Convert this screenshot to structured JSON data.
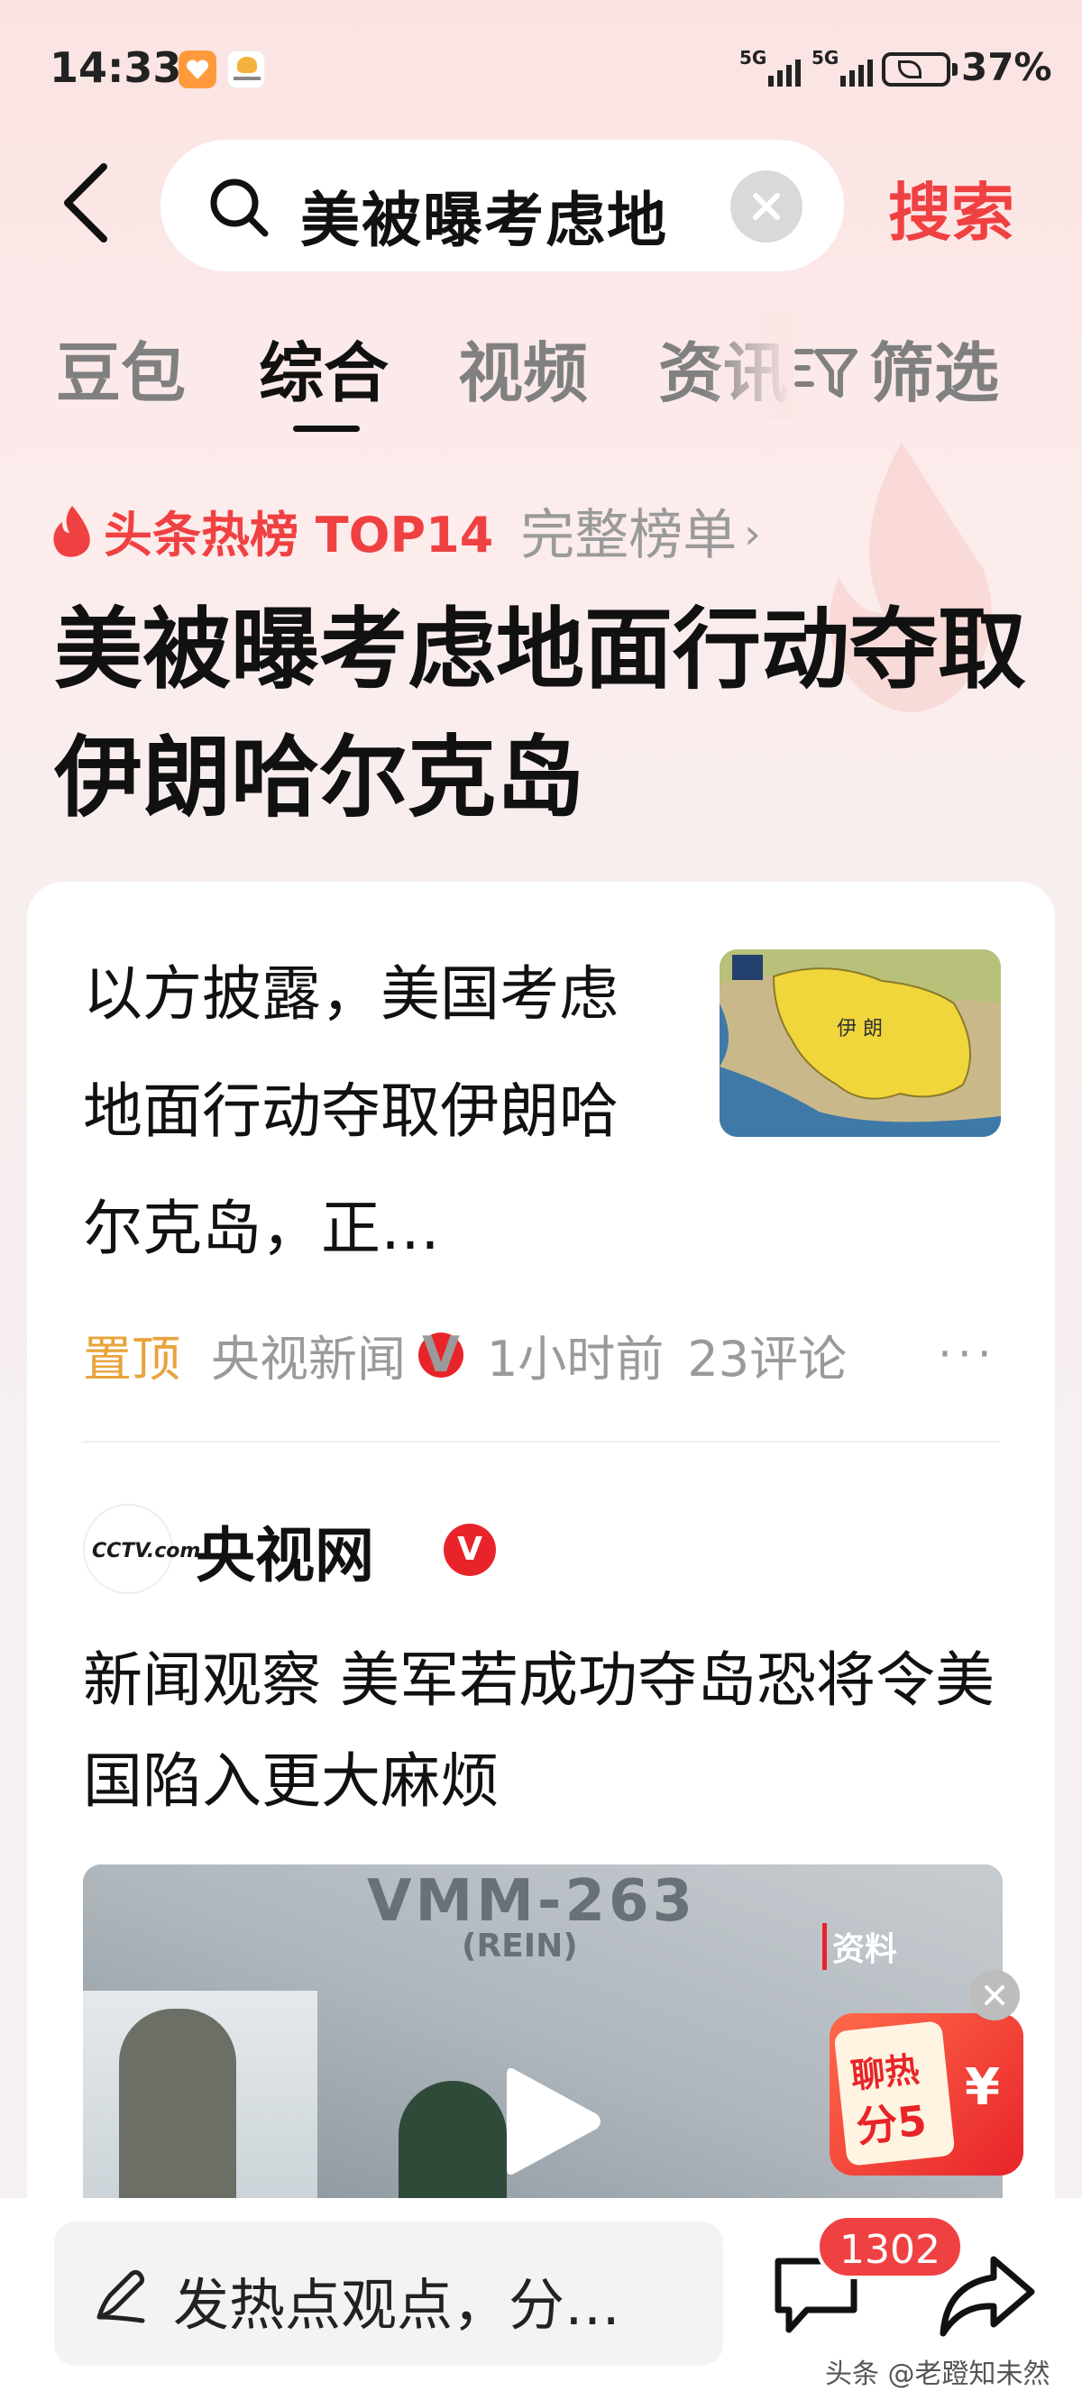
{
  "status_bar": {
    "time": "14:33",
    "network_1": "5G",
    "network_2": "5G",
    "battery_percent": "37%",
    "battery_level": 0.37
  },
  "search": {
    "query": "美被曝考虑地",
    "search_button": "搜索"
  },
  "tabs": [
    {
      "label": "豆包",
      "active": false
    },
    {
      "label": "综合",
      "active": true
    },
    {
      "label": "视频",
      "active": false
    },
    {
      "label": "资讯",
      "active": false
    }
  ],
  "filter_label": "筛选",
  "hot": {
    "tag": "头条热榜 TOP14",
    "full_list": "完整榜单",
    "title": "美被曝考虑地面行动夺取伊朗哈尔克岛"
  },
  "article1": {
    "title": "以方披露，美国考虑地面行动夺取伊朗哈尔克岛，正…",
    "thumb_label": "伊  朗",
    "pinned": "置顶",
    "source": "央视新闻",
    "verified_mark": "V",
    "time": "1小时前",
    "comments": "23评论",
    "more": "···"
  },
  "article2": {
    "author": "央视网",
    "avatar_logo": "CCTV.com",
    "verified_mark": "V",
    "title": "新闻观察 美军若成功夺岛恐将令美国陷入更大麻烦",
    "video_text_1": "VMM-263",
    "video_text_2": "(REIN)",
    "video_tag": "资料"
  },
  "promo": {
    "line1": "聊热",
    "line2": "分5",
    "currency": "¥"
  },
  "bottom": {
    "comment_placeholder": "发热点观点，分…",
    "comment_count": "1302"
  },
  "watermark": "头条 @老蹬知未然",
  "colors": {
    "accent": "#f04142",
    "pinned": "#e8a33b",
    "muted": "#9a9a9a"
  }
}
